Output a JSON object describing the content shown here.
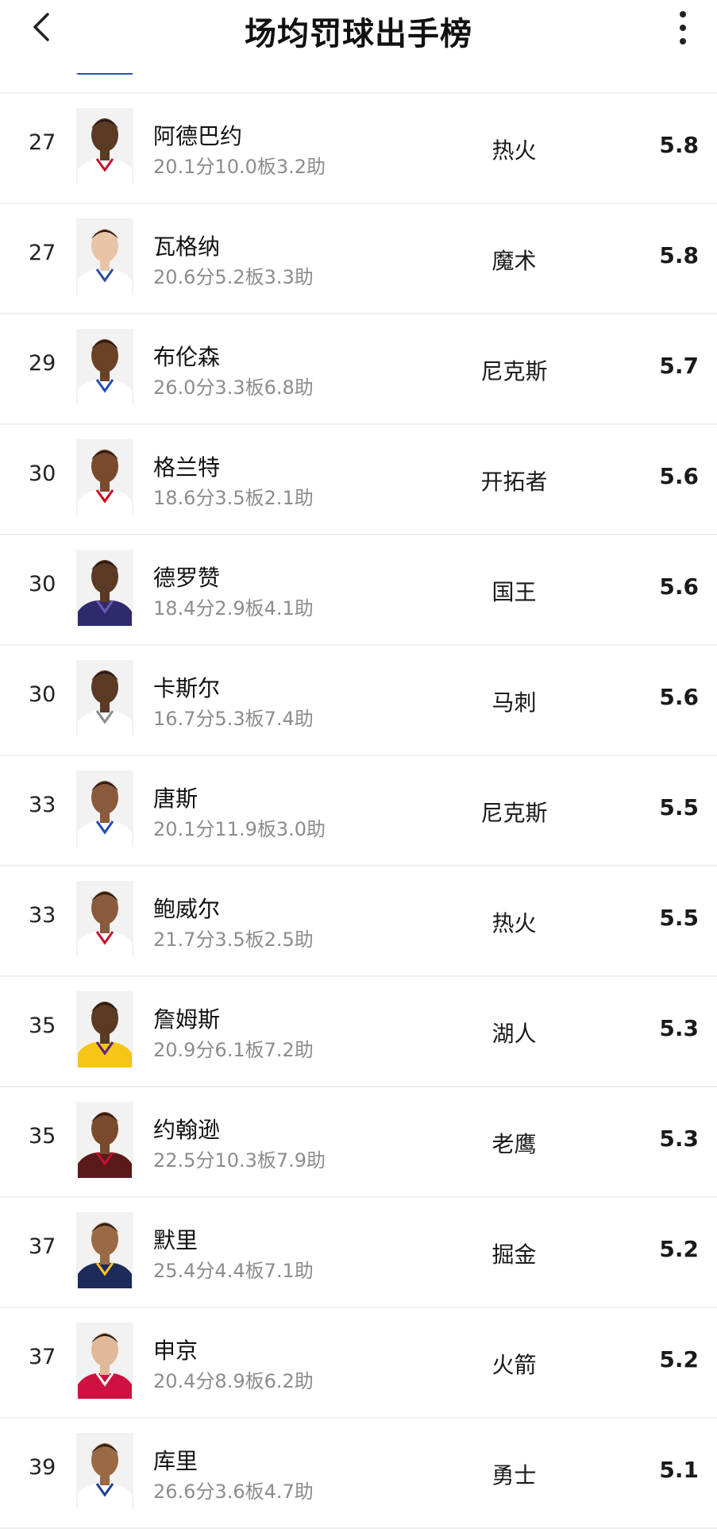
{
  "header": {
    "title": "场均罚球出手榜",
    "back_icon": "chevron-left-icon",
    "more_icon": "more-vertical-icon"
  },
  "players": [
    {
      "rank": "27",
      "name": "阿德巴约",
      "stats": "20.1分10.0板3.2助",
      "team": "热火",
      "value": "5.8",
      "jersey": "#ffffff",
      "trim": "#c8102e",
      "skin": "#5a3a24"
    },
    {
      "rank": "27",
      "name": "瓦格纳",
      "stats": "20.6分5.2板3.3助",
      "team": "魔术",
      "value": "5.8",
      "jersey": "#ffffff",
      "trim": "#2b4f9e",
      "skin": "#e8c4a8"
    },
    {
      "rank": "29",
      "name": "布伦森",
      "stats": "26.0分3.3板6.8助",
      "team": "尼克斯",
      "value": "5.7",
      "jersey": "#ffffff",
      "trim": "#1d4eb8",
      "skin": "#6b4226"
    },
    {
      "rank": "30",
      "name": "格兰特",
      "stats": "18.6分3.5板2.1助",
      "team": "开拓者",
      "value": "5.6",
      "jersey": "#ffffff",
      "trim": "#d0021b",
      "skin": "#7a4a2c"
    },
    {
      "rank": "30",
      "name": "德罗赞",
      "stats": "18.4分2.9板4.1助",
      "team": "国王",
      "value": "5.6",
      "jersey": "#2e2a6b",
      "trim": "#6b5ab8",
      "skin": "#5a3a24"
    },
    {
      "rank": "30",
      "name": "卡斯尔",
      "stats": "16.7分5.3板7.4助",
      "team": "马刺",
      "value": "5.6",
      "jersey": "#ffffff",
      "trim": "#8a8a8a",
      "skin": "#5a3a24"
    },
    {
      "rank": "33",
      "name": "唐斯",
      "stats": "20.1分11.9板3.0助",
      "team": "尼克斯",
      "value": "5.5",
      "jersey": "#ffffff",
      "trim": "#1d4eb8",
      "skin": "#8a5a3c"
    },
    {
      "rank": "33",
      "name": "鲍威尔",
      "stats": "21.7分3.5板2.5助",
      "team": "热火",
      "value": "5.5",
      "jersey": "#ffffff",
      "trim": "#c8102e",
      "skin": "#8a5a3c"
    },
    {
      "rank": "35",
      "name": "詹姆斯",
      "stats": "20.9分6.1板7.2助",
      "team": "湖人",
      "value": "5.3",
      "jersey": "#f5c518",
      "trim": "#552583",
      "skin": "#5a3a24"
    },
    {
      "rank": "35",
      "name": "约翰逊",
      "stats": "22.5分10.3板7.9助",
      "team": "老鹰",
      "value": "5.3",
      "jersey": "#5a1a1a",
      "trim": "#c8102e",
      "skin": "#7a4a2c"
    },
    {
      "rank": "37",
      "name": "默里",
      "stats": "25.4分4.4板7.1助",
      "team": "掘金",
      "value": "5.2",
      "jersey": "#1d2b5a",
      "trim": "#fec524",
      "skin": "#9a6a44"
    },
    {
      "rank": "37",
      "name": "申京",
      "stats": "20.4分8.9板6.2助",
      "team": "火箭",
      "value": "5.2",
      "jersey": "#ce1141",
      "trim": "#ffffff",
      "skin": "#e0b89a"
    },
    {
      "rank": "39",
      "name": "库里",
      "stats": "26.6分3.6板4.7助",
      "team": "勇士",
      "value": "5.1",
      "jersey": "#ffffff",
      "trim": "#1d428a",
      "skin": "#9a6a44"
    }
  ]
}
